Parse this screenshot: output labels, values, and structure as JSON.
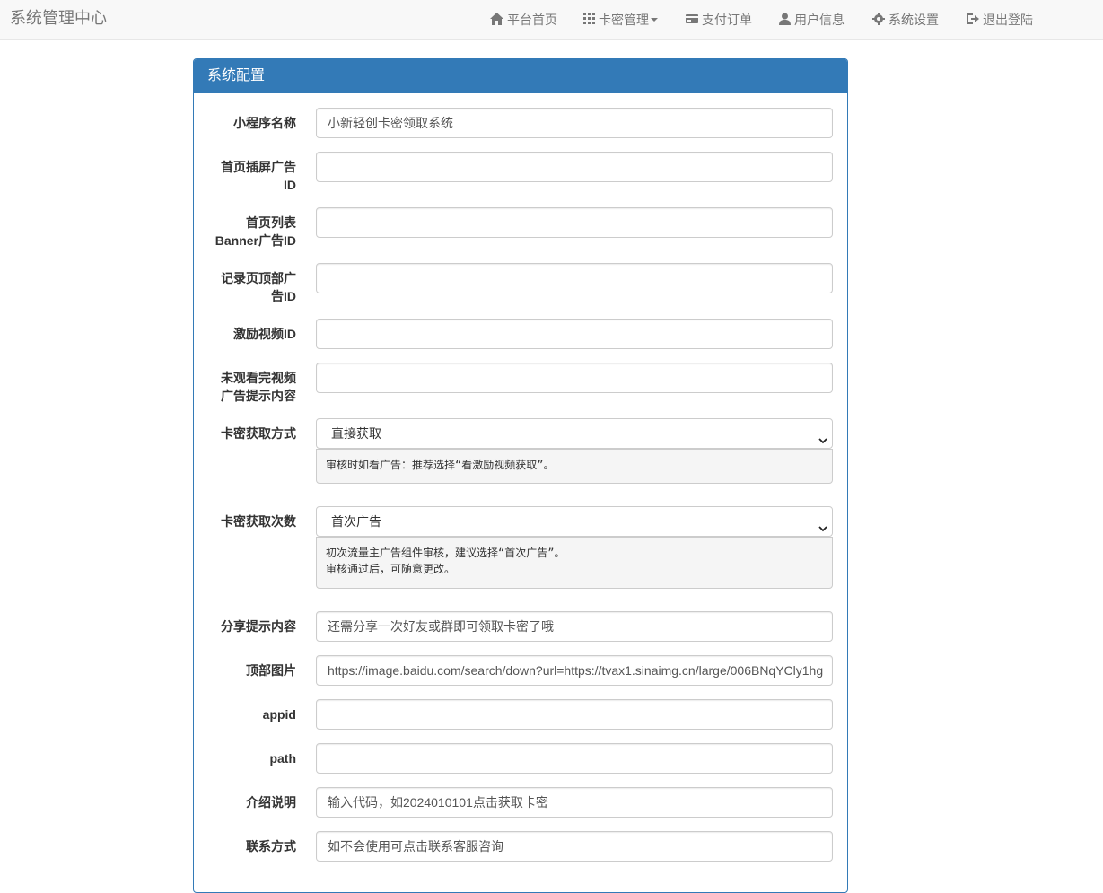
{
  "navbar": {
    "brand": "系统管理中心",
    "items": [
      {
        "label": "平台首页",
        "icon": "home-icon"
      },
      {
        "label": "卡密管理",
        "icon": "grid-icon",
        "dropdown": true
      },
      {
        "label": "支付订单",
        "icon": "credit-card-icon"
      },
      {
        "label": "用户信息",
        "icon": "user-icon"
      },
      {
        "label": "系统设置",
        "icon": "gear-icon"
      },
      {
        "label": "退出登陆",
        "icon": "logout-icon"
      }
    ]
  },
  "panel": {
    "title": "系统配置"
  },
  "form": {
    "fields": [
      {
        "label": "小程序名称",
        "value": "小新轻创卡密领取系统"
      },
      {
        "label_line1": "首页插屏广告",
        "label_line2": "ID",
        "value": ""
      },
      {
        "label_line1": "首页列表",
        "label_line2": "Banner广告ID",
        "value": ""
      },
      {
        "label_line1": "记录页顶部广",
        "label_line2": "告ID",
        "value": ""
      },
      {
        "label": "激励视频ID",
        "value": ""
      },
      {
        "label_line1": "未观看完视频",
        "label_line2": "广告提示内容",
        "value": ""
      },
      {
        "label": "卡密获取方式",
        "selected": "直接获取",
        "help": "审核时如看广告：推荐选择“看激励视频获取”。"
      },
      {
        "label": "卡密获取次数",
        "selected": "首次广告",
        "help": "初次流量主广告组件审核，建议选择“首次广告”。\n审核通过后，可随意更改。"
      },
      {
        "label": "分享提示内容",
        "value": "还需分享一次好友或群即可领取卡密了哦"
      },
      {
        "label": "顶部图片",
        "value": "https://image.baidu.com/search/down?url=https://tvax1.sinaimg.cn/large/006BNqYCly1hg"
      },
      {
        "label": "appid",
        "value": ""
      },
      {
        "label": "path",
        "value": ""
      },
      {
        "label": "介绍说明",
        "value": "输入代码，如2024010101点击获取卡密"
      },
      {
        "label": "联系方式",
        "value": "如不会使用可点击联系客服咨询"
      }
    ]
  },
  "colors": {
    "primary": "#337ab7",
    "navbar_bg": "#f8f8f8",
    "nav_text": "#777777"
  }
}
